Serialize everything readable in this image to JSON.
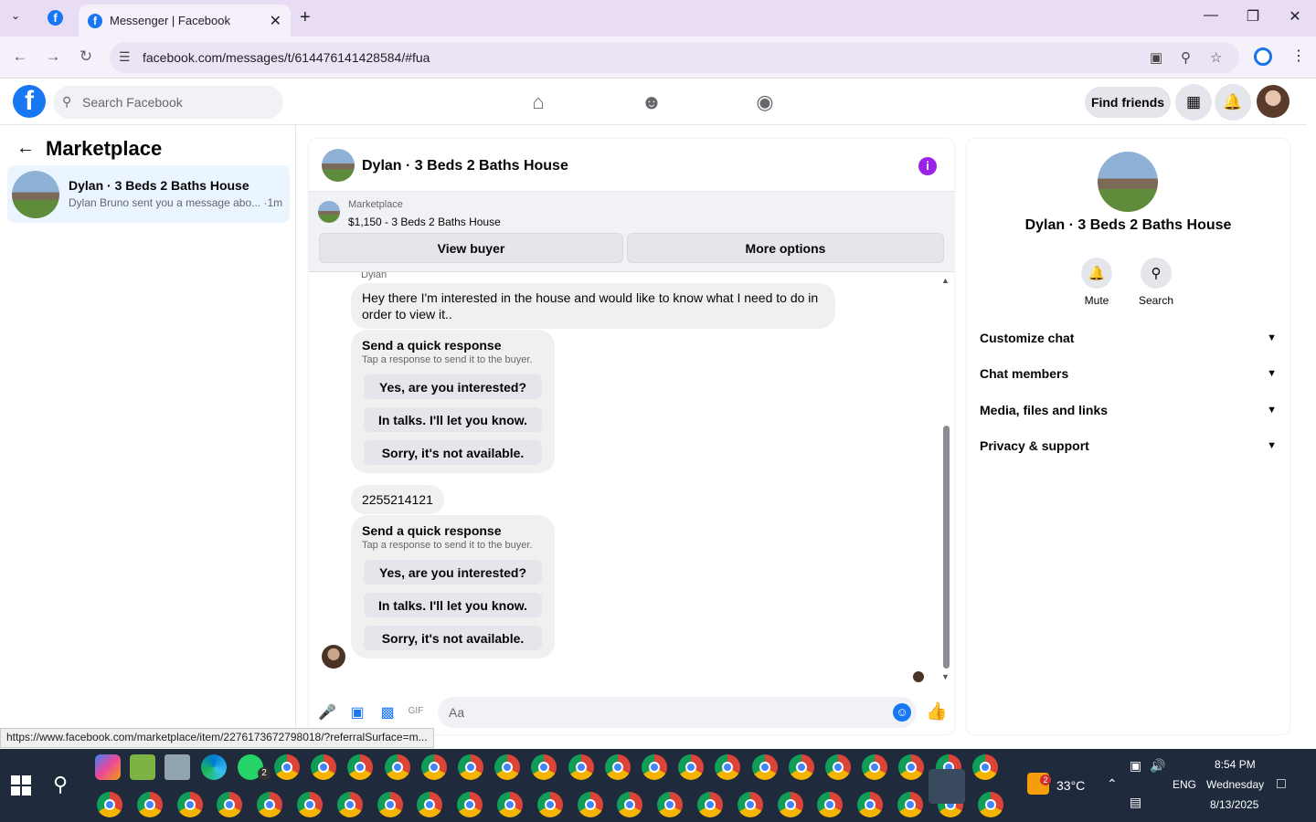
{
  "browser": {
    "tab_title": "Messenger | Facebook",
    "url": "facebook.com/messages/t/614476141428584/#fua",
    "status_url": "https://www.facebook.com/marketplace/item/2276173672798018/?referralSurface=m..."
  },
  "fb_header": {
    "search_placeholder": "Search Facebook",
    "find_friends": "Find friends"
  },
  "left_pane": {
    "title": "Marketplace",
    "conversation": {
      "name": "Dylan · 3 Beds 2 Baths House",
      "preview": "Dylan Bruno sent you a message abo... ·1m"
    }
  },
  "chat": {
    "title": "Dylan · 3 Beds 2 Baths House",
    "banner": {
      "label": "Marketplace",
      "listing": "$1,150 - 3 Beds 2 Baths House",
      "view_buyer": "View buyer",
      "more_options": "More options"
    },
    "sender_name": "Dylan",
    "messages": {
      "m1": "Hey there I'm interested in the house and would like to know what I need to do in order to view it..",
      "m2": "2255214121"
    },
    "quick_response": {
      "title": "Send a quick response",
      "subtitle": "Tap a response to send it to the buyer.",
      "options": [
        "Yes, are you interested?",
        "In talks. I'll let you know.",
        "Sorry, it's not available."
      ]
    },
    "input_placeholder": "Aa"
  },
  "right_pane": {
    "name": "Dylan · 3 Beds 2 Baths House",
    "actions": {
      "mute": "Mute",
      "search": "Search"
    },
    "sections": [
      "Customize chat",
      "Chat members",
      "Media, files and links",
      "Privacy & support"
    ]
  },
  "taskbar": {
    "weather": "33°C",
    "language": "ENG",
    "time": "8:54 PM",
    "day": "Wednesday",
    "date": "8/13/2025",
    "whatsapp_badge": "2",
    "weather_badge": "2"
  },
  "colors": {
    "fb_blue": "#1877f2",
    "info_purple": "#9b23e8",
    "tab_strip": "#e9dcf5",
    "taskbar": "#1f2b3c"
  }
}
